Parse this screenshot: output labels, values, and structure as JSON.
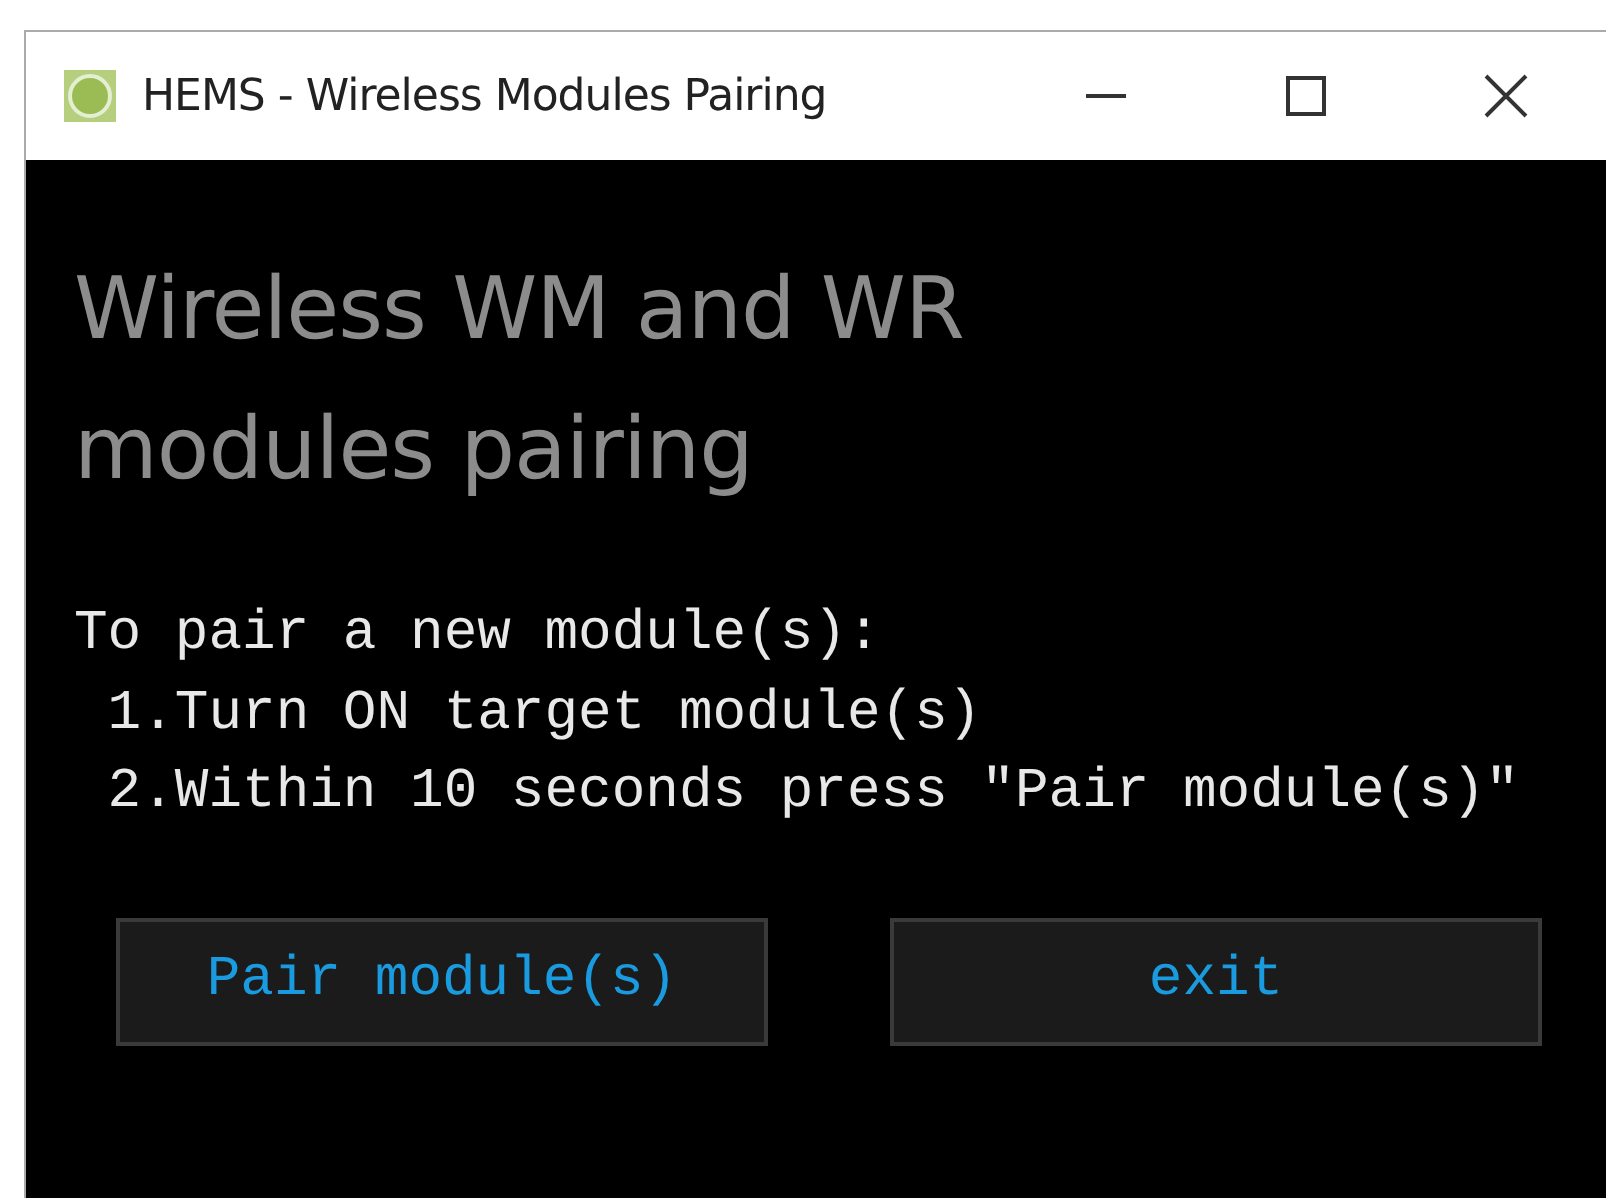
{
  "window": {
    "title": "HEMS - Wireless Modules Pairing"
  },
  "heading": "Wireless WM and WR modules pairing",
  "instructions": [
    "To pair a new module(s):",
    " 1.Turn ON target module(s)",
    " 2.Within 10 seconds press \"Pair module(s)\""
  ],
  "buttons": [
    {
      "label": "Pair module(s)"
    },
    {
      "label": "exit"
    }
  ]
}
